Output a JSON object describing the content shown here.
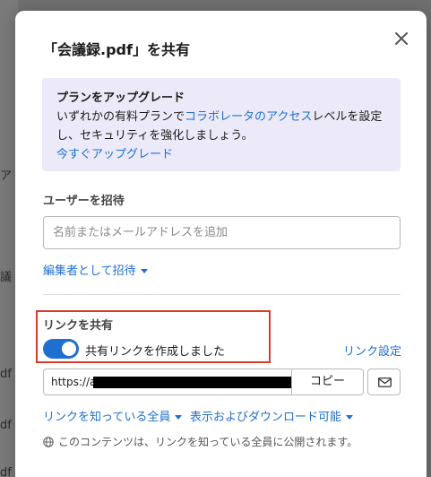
{
  "background": {
    "rows": [
      "ア",
      "議",
      "df",
      "df",
      "df"
    ]
  },
  "dialog": {
    "title": "「会議録.pdf」を共有",
    "close_icon": "close-icon",
    "upgrade": {
      "title": "プランをアップグレード",
      "text_before": "いずれかの有料プランで",
      "text_link": "コラボレータのアクセス",
      "text_after": "レベルを設定し、セキュリティを強化しましょう。",
      "cta": "今すぐアップグレード"
    },
    "invite": {
      "label": "ユーザーを招待",
      "placeholder": "名前またはメールアドレスを追加",
      "role": "編集者として招待"
    },
    "share_link": {
      "label": "リンクを共有",
      "toggle_on": true,
      "toggle_label": "共有リンクを作成しました",
      "settings": "リンク設定",
      "url_prefix": "https://a",
      "copy": "コピー",
      "audience": "リンクを知っている全員",
      "permission": "表示およびダウンロード可能",
      "notice": "このコンテンツは、リンクを知っている全員に公開されます。"
    }
  },
  "colors": {
    "accent": "#1e6fcf",
    "upgrade_bg": "#eceaf8",
    "highlight": "#d93a2b"
  }
}
